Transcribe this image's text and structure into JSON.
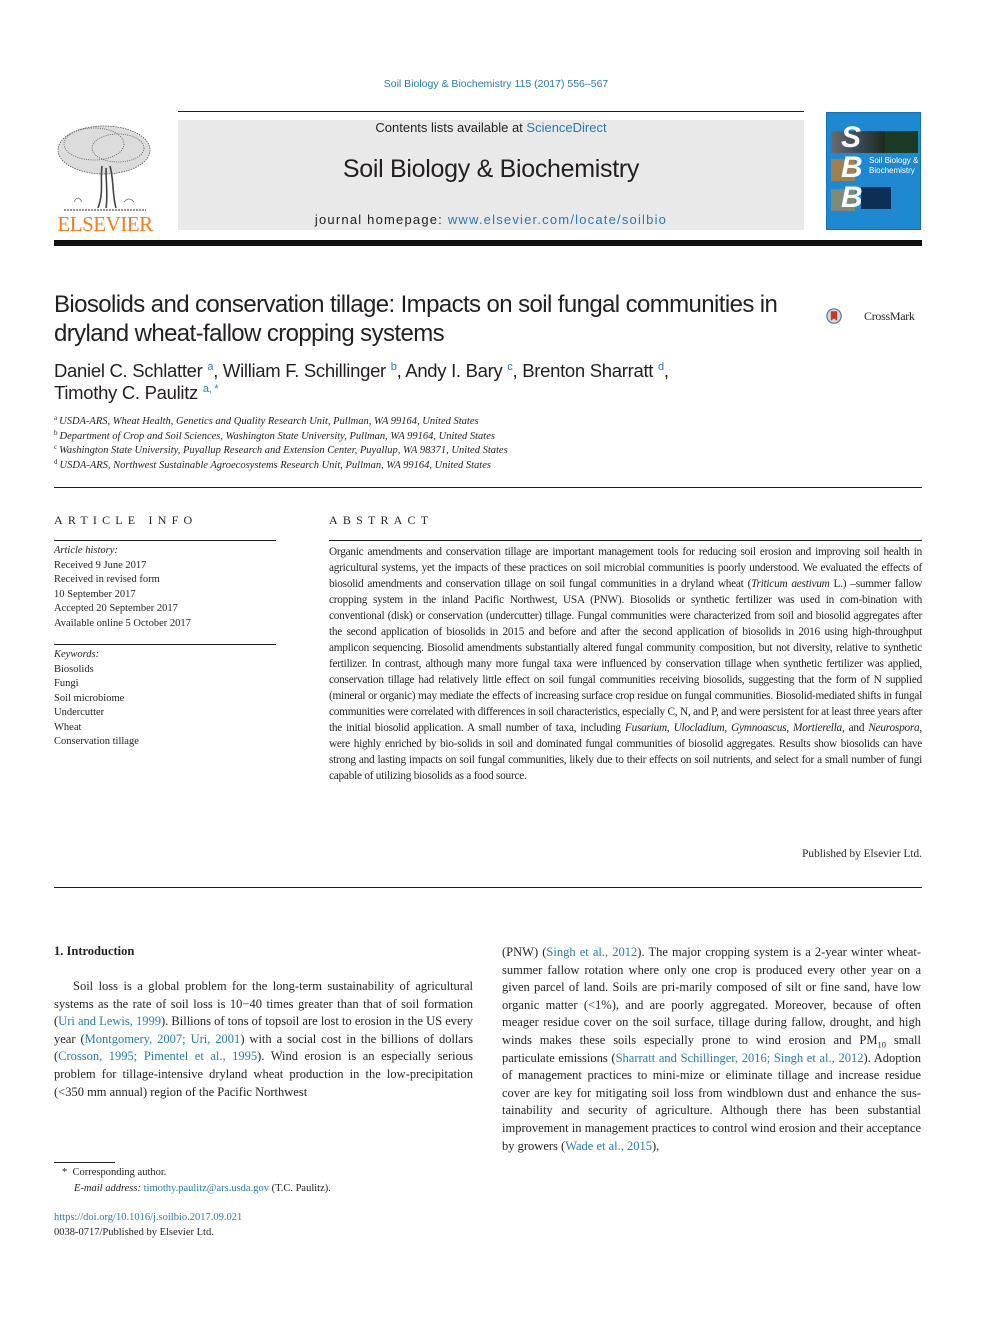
{
  "citation": "Soil Biology & Biochemistry 115 (2017) 556–567",
  "masthead": {
    "publisher_logo_text": "ELSEVIER",
    "contents_prefix": "Contents lists available at ",
    "contents_link": "ScienceDirect",
    "journal_name": "Soil Biology & Biochemistry",
    "homepage_prefix": "journal homepage: ",
    "homepage_link": "www.elsevier.com/locate/soilbio",
    "cover": {
      "letters": [
        "S",
        "B",
        "B"
      ],
      "title_line1": "Soil Biology &",
      "title_line2": "Biochemistry",
      "color": "#1e88d0"
    }
  },
  "crossmark_label": "CrossMark",
  "article": {
    "title": "Biosolids and conservation tillage: Impacts on soil fungal communities in dryland wheat-fallow cropping systems",
    "authors": [
      {
        "name": "Daniel C. Schlatter",
        "aff": "a"
      },
      {
        "name": "William F. Schillinger",
        "aff": "b"
      },
      {
        "name": "Andy I. Bary",
        "aff": "c"
      },
      {
        "name": "Brenton Sharratt",
        "aff": "d"
      },
      {
        "name": "Timothy C. Paulitz",
        "aff": "a, *"
      }
    ],
    "affiliations": [
      {
        "key": "a",
        "text": "USDA-ARS, Wheat Health, Genetics and Quality Research Unit, Pullman, WA 99164, United States"
      },
      {
        "key": "b",
        "text": "Department of Crop and Soil Sciences, Washington State University, Pullman, WA 99164, United States"
      },
      {
        "key": "c",
        "text": "Washington State University, Puyallup Research and Extension Center, Puyallup, WA 98371, United States"
      },
      {
        "key": "d",
        "text": "USDA-ARS, Northwest Sustainable Agroecosystems Research Unit, Pullman, WA 99164, United States"
      }
    ]
  },
  "article_info": {
    "heading": "ARTICLE INFO",
    "history_label": "Article history:",
    "history": [
      "Received 9 June 2017",
      "Received in revised form",
      "10 September 2017",
      "Accepted 20 September 2017",
      "Available online 5 October 2017"
    ],
    "keywords_label": "Keywords:",
    "keywords": [
      "Biosolids",
      "Fungi",
      "Soil microbiome",
      "Undercutter",
      "Wheat",
      "Conservation tillage"
    ]
  },
  "abstract": {
    "heading": "ABSTRACT",
    "p1": "Organic amendments and conservation tillage are important management tools for reducing soil erosion and improving soil health in agricultural systems, yet the impacts of these practices on soil microbial communities is poorly understood. We evaluated the effects of biosolid amendments and conservation tillage on soil fungal communities in a dryland wheat (",
    "species": "Triticum aestivum",
    "p2": " L.) –summer fallow cropping system in the inland Pacific Northwest, USA (PNW). Biosolids or synthetic fertilizer was used in com-bination with conventional (disk) or conservation (undercutter) tillage. Fungal communities were characterized from soil and biosolid aggregates after the second application of biosolids in 2015 and before and after the second application of biosolids in 2016 using high-throughput amplicon sequencing. Biosolid amendments substantially altered fungal community composition, but not diversity, relative to synthetic fertilizer. In contrast, although many more fungal taxa were influenced by conservation tillage when synthetic fertilizer was applied, conservation tillage had relatively little effect on soil fungal communities receiving biosolids, suggesting that the form of N supplied (mineral or organic) may mediate the effects of increasing surface crop residue on fungal communities. Biosolid-mediated shifts in fungal communities were correlated with differences in soil characteristics, especially C, N, and P, and were persistent for at least three years after the initial biosolid application. A small number of taxa, including ",
    "taxa": [
      "Fusarium",
      "Ulocladium",
      "Gymnoascus",
      "Mortierella",
      "Neurospora"
    ],
    "p3": ", were highly enriched by bio-solids in soil and dominated fungal communities of biosolid aggregates. Results show biosolids can have strong and lasting impacts on soil fungal communities, likely due to their effects on soil nutrients, and select for a small number of fungi capable of utilizing biosolids as a food source.",
    "publisher_note": "Published by Elsevier Ltd."
  },
  "introduction": {
    "heading": "1.  Introduction",
    "left": [
      {
        "t": "Soil loss is a global problem for the long-term sustainability of agricultural systems as the rate of soil loss is 10−40 times greater than that of soil formation ("
      },
      {
        "l": "Uri and Lewis, 1999"
      },
      {
        "t": "). Billions of tons of topsoil are lost to erosion in the US every year ("
      },
      {
        "l": "Montgomery, 2007; Uri, 2001"
      },
      {
        "t": ") with a social cost in the billions of dollars ("
      },
      {
        "l": "Crosson, 1995; Pimentel et al., 1995"
      },
      {
        "t": "). Wind erosion is an especially serious problem for tillage-intensive dryland wheat production in the low-precipitation (<350 mm annual) region of the Pacific Northwest"
      }
    ],
    "right": [
      {
        "t": "(PNW) ("
      },
      {
        "l": "Singh et al., 2012"
      },
      {
        "t": "). The major cropping system is a 2-year winter wheat-summer fallow rotation where only one crop is produced every other year on a given parcel of land. Soils are pri-marily composed of silt or fine sand, have low organic matter (<1%), and are poorly aggregated. Moreover, because of often meager residue cover on the soil surface, tillage during fallow, drought, and high winds makes these soils especially prone to wind erosion and PM"
      },
      {
        "sub": "10"
      },
      {
        "t": " small particulate emissions ("
      },
      {
        "l": "Sharratt and Schillinger, 2016; Singh et al., 2012"
      },
      {
        "t": "). Adoption of management practices to mini-mize or eliminate tillage and increase residue cover are key for mitigating soil loss from windblown dust and enhance the sus-tainability and security of agriculture. Although there has been substantial improvement in management practices to control wind erosion and their acceptance by growers ("
      },
      {
        "l": "Wade et al., 2015"
      },
      {
        "t": "),"
      }
    ]
  },
  "footnote": {
    "marker": "*",
    "corresponding": "Corresponding author.",
    "email_label": "E-mail address:",
    "email": "timothy.paulitz@ars.usda.gov",
    "email_suffix": " (T.C. Paulitz)."
  },
  "doi": "https://doi.org/10.1016/j.soilbio.2017.09.021",
  "issn_line": "0038-0717/Published by Elsevier Ltd.",
  "colors": {
    "link": "#2a7ab3",
    "elsevier_orange": "#f47b20",
    "masthead_gray": "#e9e9e9"
  }
}
